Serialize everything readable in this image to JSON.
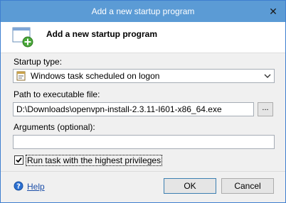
{
  "window": {
    "title": "Add a new startup program",
    "close_glyph": "✕"
  },
  "header": {
    "title": "Add a new startup program",
    "icon": "window-add-icon"
  },
  "form": {
    "startup_type_label": "Startup type:",
    "startup_type_value": "Windows task scheduled on logon",
    "startup_type_icon": "scheduled-task-icon",
    "path_label": "Path to executable file:",
    "path_value": "D:\\Downloads\\openvpn-install-2.3.11-I601-x86_64.exe",
    "browse_label": "...",
    "arguments_label": "Arguments (optional):",
    "arguments_value": "",
    "run_highest_label": "Run task with the highest privileges",
    "run_highest_checked": true
  },
  "footer": {
    "help_label": "Help",
    "help_icon": "question-icon",
    "ok_label": "OK",
    "cancel_label": "Cancel"
  },
  "colors": {
    "titlebar": "#5b9bd5",
    "link": "#1c4ea8",
    "window_bg": "#f0f0f0"
  }
}
